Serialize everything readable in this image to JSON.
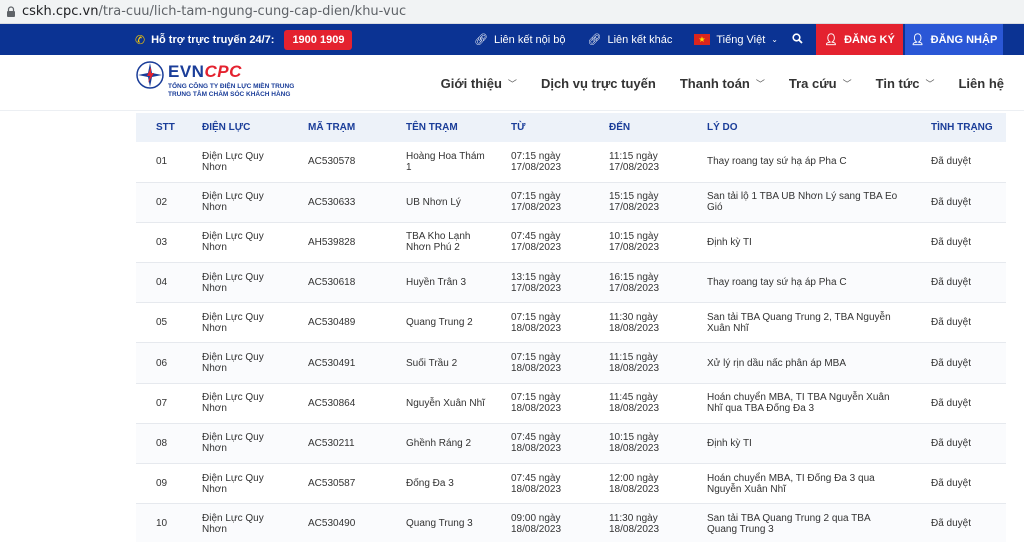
{
  "browser": {
    "url_host": "cskh.cpc.vn",
    "url_path": "/tra-cuu/lich-tam-ngung-cung-cap-dien/khu-vuc"
  },
  "topbar": {
    "hotline_label": "Hỗ trợ trực truyến 24/7:",
    "hotline_number": "1900 1909",
    "link_internal": "Liên kết nội bộ",
    "link_other": "Liên kết khác",
    "language": "Tiếng Việt",
    "register": "ĐĂNG KÝ",
    "login": "ĐĂNG NHẬP"
  },
  "logo": {
    "brand_evn": "EVN",
    "brand_cpc": "CPC",
    "sub1": "TỔNG CÔNG TY ĐIỆN LỰC MIỀN TRUNG",
    "sub2": "TRUNG TÂM CHĂM SÓC KHÁCH HÀNG"
  },
  "nav": {
    "items": [
      {
        "label": "Giới thiệu"
      },
      {
        "label": "Dịch vụ trực tuyến"
      },
      {
        "label": "Thanh toán"
      },
      {
        "label": "Tra cứu"
      },
      {
        "label": "Tin tức"
      },
      {
        "label": "Liên hệ"
      }
    ]
  },
  "table": {
    "headers": [
      "STT",
      "ĐIỆN LỰC",
      "MÃ TRẠM",
      "TÊN TRẠM",
      "TỪ",
      "ĐẾN",
      "LÝ DO",
      "TÌNH TRẠNG"
    ],
    "rows": [
      {
        "stt": "01",
        "dl1": "Điện Lực Quy",
        "dl2": "Nhơn",
        "ma": "AC530578",
        "ten1": "Hoàng Hoa Thám",
        "ten2": "1",
        "tu1": "07:15 ngày",
        "tu2": "17/08/2023",
        "den1": "11:15 ngày",
        "den2": "17/08/2023",
        "ld1": "Thay roang tay sứ hạ áp Pha C",
        "ld2": "",
        "tt": "Đã duyệt"
      },
      {
        "stt": "02",
        "dl1": "Điện Lực Quy",
        "dl2": "Nhơn",
        "ma": "AC530633",
        "ten1": "UB Nhơn Lý",
        "ten2": "",
        "tu1": "07:15 ngày",
        "tu2": "17/08/2023",
        "den1": "15:15 ngày",
        "den2": "17/08/2023",
        "ld1": "San tải lộ 1 TBA UB Nhơn Lý sang TBA Eo",
        "ld2": "Gió",
        "tt": "Đã duyệt"
      },
      {
        "stt": "03",
        "dl1": "Điện Lực Quy",
        "dl2": "Nhơn",
        "ma": "AH539828",
        "ten1": "TBA Kho Lạnh",
        "ten2": "Nhơn Phú 2",
        "tu1": "07:45 ngày",
        "tu2": "17/08/2023",
        "den1": "10:15 ngày",
        "den2": "17/08/2023",
        "ld1": "Định kỳ TI",
        "ld2": "",
        "tt": "Đã duyệt"
      },
      {
        "stt": "04",
        "dl1": "Điện Lực Quy",
        "dl2": "Nhơn",
        "ma": "AC530618",
        "ten1": "Huyền Trân 3",
        "ten2": "",
        "tu1": "13:15 ngày",
        "tu2": "17/08/2023",
        "den1": "16:15 ngày",
        "den2": "17/08/2023",
        "ld1": "Thay roang tay sứ hạ áp Pha C",
        "ld2": "",
        "tt": "Đã duyệt"
      },
      {
        "stt": "05",
        "dl1": "Điện Lực Quy",
        "dl2": "Nhơn",
        "ma": "AC530489",
        "ten1": "Quang Trung 2",
        "ten2": "",
        "tu1": "07:15 ngày",
        "tu2": "18/08/2023",
        "den1": "11:30 ngày",
        "den2": "18/08/2023",
        "ld1": "San tải TBA Quang Trung 2, TBA Nguyễn",
        "ld2": "Xuân Nhĩ",
        "tt": "Đã duyệt"
      },
      {
        "stt": "06",
        "dl1": "Điện Lực Quy",
        "dl2": "Nhơn",
        "ma": "AC530491",
        "ten1": "Suối Trầu 2",
        "ten2": "",
        "tu1": "07:15 ngày",
        "tu2": "18/08/2023",
        "den1": "11:15 ngày",
        "den2": "18/08/2023",
        "ld1": "Xử lý rịn dầu nấc phân áp MBA",
        "ld2": "",
        "tt": "Đã duyệt"
      },
      {
        "stt": "07",
        "dl1": "Điện Lực Quy",
        "dl2": "Nhơn",
        "ma": "AC530864",
        "ten1": "Nguyễn Xuân Nhĩ",
        "ten2": "",
        "tu1": "07:15 ngày",
        "tu2": "18/08/2023",
        "den1": "11:45 ngày",
        "den2": "18/08/2023",
        "ld1": "Hoán chuyển MBA, TI TBA Nguyễn Xuân",
        "ld2": "Nhĩ qua TBA Đống Đa 3",
        "tt": "Đã duyệt"
      },
      {
        "stt": "08",
        "dl1": "Điện Lực Quy",
        "dl2": "Nhơn",
        "ma": "AC530211",
        "ten1": "Ghềnh Ráng 2",
        "ten2": "",
        "tu1": "07:45 ngày",
        "tu2": "18/08/2023",
        "den1": "10:15 ngày",
        "den2": "18/08/2023",
        "ld1": "Định kỳ TI",
        "ld2": "",
        "tt": "Đã duyệt"
      },
      {
        "stt": "09",
        "dl1": "Điện Lực Quy",
        "dl2": "Nhơn",
        "ma": "AC530587",
        "ten1": "Đống Đa 3",
        "ten2": "",
        "tu1": "07:45 ngày",
        "tu2": "18/08/2023",
        "den1": "12:00 ngày",
        "den2": "18/08/2023",
        "ld1": "Hoán chuyển MBA, TI Đống Đa 3 qua",
        "ld2": "Nguyễn Xuân Nhĩ",
        "tt": "Đã duyệt"
      },
      {
        "stt": "10",
        "dl1": "Điện Lực Quy",
        "dl2": "Nhơn",
        "ma": "AC530490",
        "ten1": "Quang Trung 3",
        "ten2": "",
        "tu1": "09:00 ngày",
        "tu2": "18/08/2023",
        "den1": "11:30 ngày",
        "den2": "18/08/2023",
        "ld1": "San tải TBA Quang Trung 2 qua TBA",
        "ld2": "Quang Trung 3",
        "tt": "Đã duyệt"
      }
    ]
  },
  "colors": {
    "topbar_bg": "#0b3393",
    "register_bg": "#e4222f",
    "login_bg": "#2a57d6",
    "header_text_blue": "#1a3d99"
  }
}
